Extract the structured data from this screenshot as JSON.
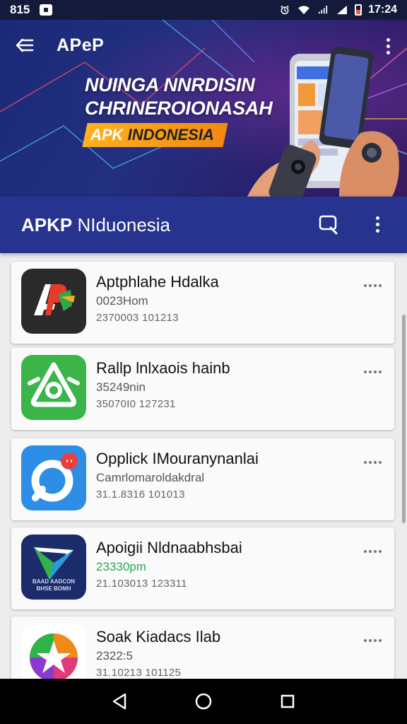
{
  "status_bar": {
    "time_left": "815",
    "time_right": "17:24"
  },
  "hero": {
    "brand": "APeP",
    "headline_line1": "NUINGA NNRDISIN",
    "headline_line2": "CHRINEROIONASAH",
    "tag_part1": "APK",
    "tag_part2": "INDONESIA"
  },
  "header": {
    "title_bold": "APKP",
    "title_rest": " NIduonesia"
  },
  "apps": [
    {
      "name": "Aptphlahe Hdalka",
      "sub": "0023Hom",
      "date": "2370003 101213",
      "icon": "app-dark-logo-icon"
    },
    {
      "name": "Rallp lnlxaois hainb",
      "sub": "35249nin",
      "date": "35070I0 127231",
      "icon": "app-green-triangle-icon"
    },
    {
      "name": "Opplick IMouranynanlai",
      "sub": "Camrlomaroldakdral",
      "date": "31.1.8316 101013",
      "icon": "app-blue-circle-icon"
    },
    {
      "name": "Apoigii Nldnaabhsbai",
      "sub": "23330pm",
      "sub_green": true,
      "date": "21.103013 123311",
      "icon": "app-navy-arrow-icon",
      "icon_caption": "BAAD AADCON BHSE BOMH"
    },
    {
      "name": "Soak Kiadacs Ilab",
      "sub": "2322:5",
      "date": "31.10213 101125",
      "icon": "app-color-star-icon"
    }
  ],
  "colors": {
    "header": "#26338f",
    "hero_dark": "#1a2a78",
    "tag": "#f5a019",
    "green": "#2aa84a",
    "blue": "#2d8ee6"
  }
}
